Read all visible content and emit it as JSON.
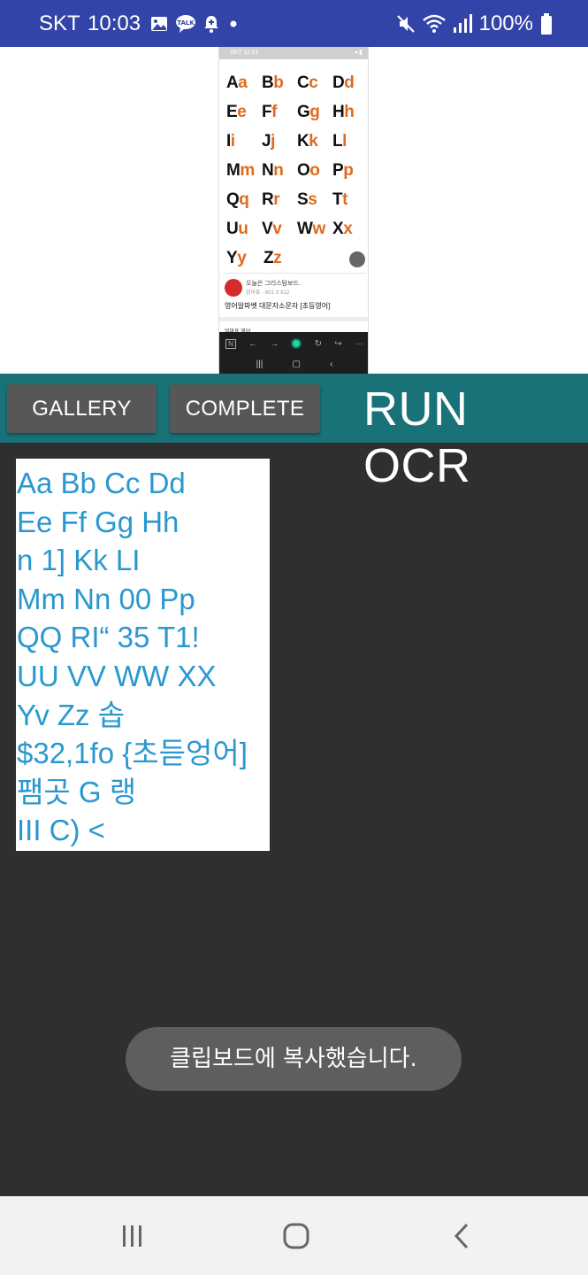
{
  "status_bar": {
    "carrier": "SKT",
    "time": "10:03",
    "battery": "100%",
    "left_icons": [
      "image-icon",
      "talk-icon",
      "notification-bell-icon",
      "dot-icon"
    ],
    "right_icons": [
      "mute-icon",
      "wifi-icon",
      "signal-icon",
      "battery-icon"
    ]
  },
  "preview": {
    "thumb_status": "SKT 11:01",
    "letters": [
      [
        [
          "A",
          "a"
        ],
        [
          "B",
          "b"
        ],
        [
          "C",
          "c"
        ],
        [
          "D",
          "d"
        ]
      ],
      [
        [
          "E",
          "e"
        ],
        [
          "F",
          "f"
        ],
        [
          "G",
          "g"
        ],
        [
          "H",
          "h"
        ]
      ],
      [
        [
          "I",
          "i"
        ],
        [
          "J",
          "j"
        ],
        [
          "K",
          "k"
        ],
        [
          "L",
          "l"
        ]
      ],
      [
        [
          "M",
          "m"
        ],
        [
          "N",
          "n"
        ],
        [
          "O",
          "o"
        ],
        [
          "P",
          "p"
        ]
      ],
      [
        [
          "Q",
          "q"
        ],
        [
          "R",
          "r"
        ],
        [
          "S",
          "s"
        ],
        [
          "T",
          "t"
        ]
      ],
      [
        [
          "U",
          "u"
        ],
        [
          "V",
          "v"
        ],
        [
          "W",
          "w"
        ],
        [
          "X",
          "x"
        ]
      ],
      [
        [
          "Y",
          "y"
        ],
        [
          "Z",
          "z"
        ]
      ]
    ],
    "blog_name": "오늘은 그리스탐보드.",
    "blog_meta": "엄마표 · 601 X 812",
    "post_title": "영어알파벳 대문자소문자 [초등영어]",
    "small_text": "엄마표 영어"
  },
  "toolbar": {
    "gallery_label": "GALLERY",
    "complete_label": "COMPLETE",
    "run_label": "RUN OCR"
  },
  "ocr_result": {
    "lines": [
      "Aa Bb Cc Dd",
      "Ee Ff Gg Hh",
      "n 1] Kk LI",
      "Mm Nn 00 Pp",
      "QQ RI“ 35 T1!",
      "UU VV WW XX",
      "Yv Zz 솝",
      "$32,1fo {초듣엉어]",
      "팸곳 G 랭",
      "III C) <"
    ]
  },
  "toast": {
    "message": "클립보드에 복사했습니다."
  },
  "nav_bar": {
    "icons": [
      "recent-apps-icon",
      "home-icon",
      "back-icon"
    ]
  }
}
